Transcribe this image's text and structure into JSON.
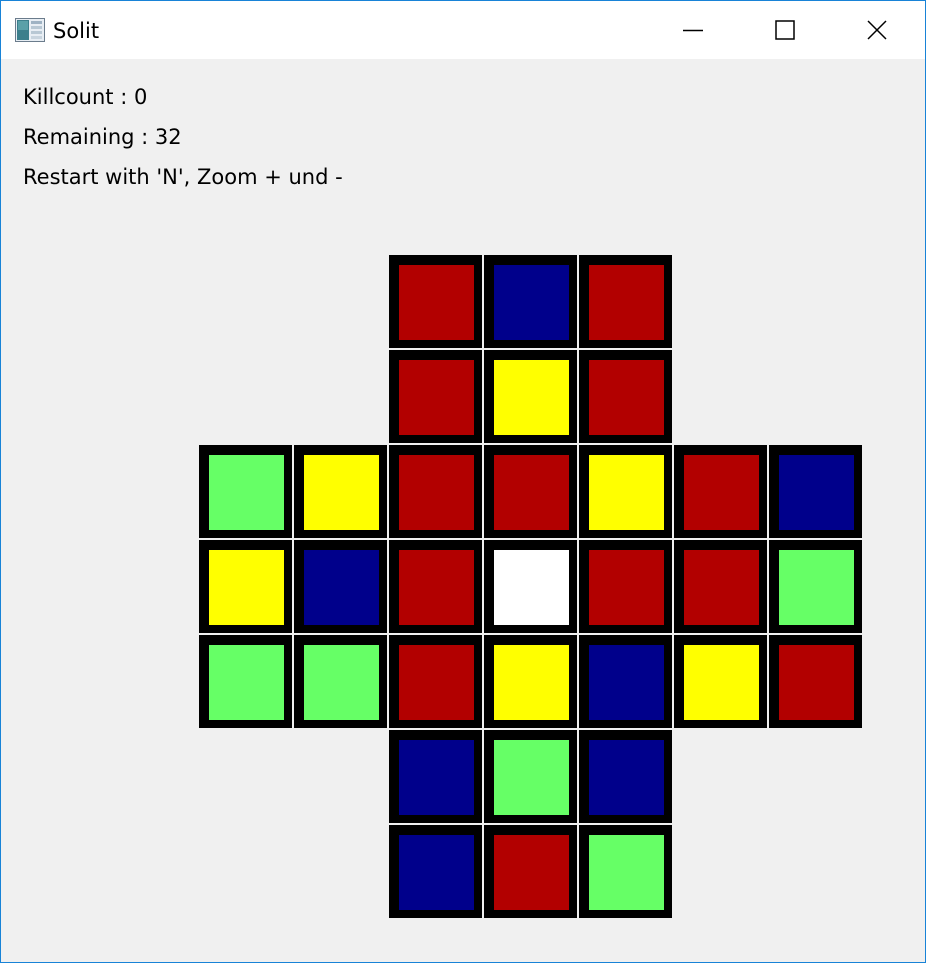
{
  "window": {
    "title": "Solit",
    "icon": "app-window-icon",
    "controls": [
      "minimize-icon",
      "maximize-icon",
      "close-icon"
    ]
  },
  "info": {
    "killcount": "Killcount : 0",
    "remaining": "Remaining : 32",
    "hint": "Restart with 'N', Zoom + und -"
  },
  "colors": {
    "red": "#b20000",
    "blue": "#00008b",
    "yellow": "#ffff00",
    "green": "#66ff66",
    "white": "#ffffff",
    "cell_border": "#000000",
    "grid_gap": "#ffffff"
  },
  "board": {
    "rows": [
      [
        null,
        null,
        "red",
        "blue",
        "red",
        null,
        null
      ],
      [
        null,
        null,
        "red",
        "yellow",
        "red",
        null,
        null
      ],
      [
        "green",
        "yellow",
        "red",
        "red",
        "yellow",
        "red",
        "blue"
      ],
      [
        "yellow",
        "blue",
        "red",
        "white",
        "red",
        "red",
        "green"
      ],
      [
        "green",
        "green",
        "red",
        "yellow",
        "blue",
        "yellow",
        "red"
      ],
      [
        null,
        null,
        "blue",
        "green",
        "blue",
        null,
        null
      ],
      [
        null,
        null,
        "blue",
        "red",
        "green",
        null,
        null
      ]
    ]
  }
}
